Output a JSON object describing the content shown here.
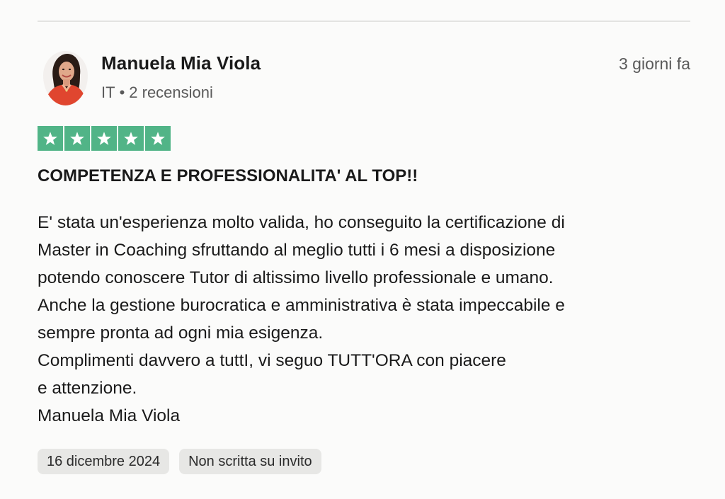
{
  "reviewer": {
    "name": "Manuela Mia Viola",
    "country": "IT",
    "separator": "•",
    "reviews_count": "2 recensioni"
  },
  "review": {
    "date_relative": "3 giorni fa",
    "rating": 5,
    "rating_max": 5,
    "title": "COMPETENZA E PROFESSIONALITA' AL TOP!!",
    "body_lines": [
      "E' stata un'esperienza molto valida, ho conseguito la certificazione di",
      "Master in Coaching sfruttando al meglio tutti i 6 mesi a disposizione",
      "potendo conoscere Tutor di altissimo livello professionale e umano.",
      "Anche la gestione burocratica e amministrativa è stata impeccabile e",
      "sempre pronta ad ogni mia esigenza.",
      "Complimenti davvero a tuttI, vi seguo TUTT'ORA con piacere",
      "e attenzione.",
      "Manuela Mia Viola"
    ],
    "tags": [
      "16 dicembre 2024",
      "Non scritta su invito"
    ]
  },
  "colors": {
    "star_fill": "#51b487",
    "star_glyph": "#ffffff",
    "divider": "#e3e3e1",
    "tag_bg": "#e7e7e5",
    "meta_text": "#5a5a5a"
  },
  "icons": {
    "star": "star-icon",
    "avatar": "avatar"
  }
}
